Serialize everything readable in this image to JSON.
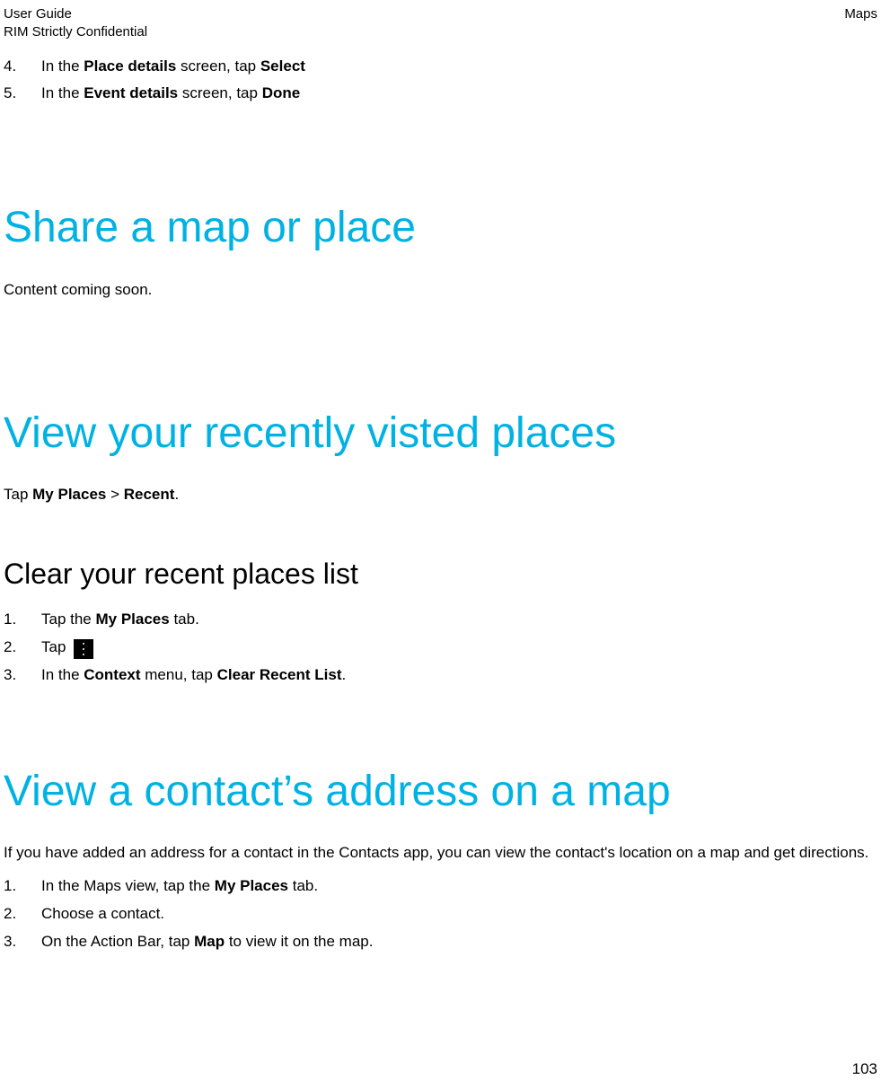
{
  "header": {
    "left_line1": "User Guide",
    "left_line2": "RIM Strictly Confidential",
    "right": "Maps"
  },
  "top_steps": [
    {
      "num": "4.",
      "pre": "In the ",
      "b1": "Place details",
      "mid": " screen, tap ",
      "b2": "Select",
      "post": ""
    },
    {
      "num": "5.",
      "pre": "In the ",
      "b1": "Event details",
      "mid": " screen, tap ",
      "b2": "Done",
      "post": ""
    }
  ],
  "section1": {
    "title": "Share a map or place",
    "body": "Content coming soon."
  },
  "section2": {
    "title": "View your recently visted places",
    "tap_line": {
      "pre": "Tap ",
      "b1": "My Places",
      "sep": " > ",
      "b2": "Recent",
      "post": "."
    },
    "sub_title": "Clear your recent places list",
    "steps": [
      {
        "num": "1.",
        "pre": "Tap the ",
        "b1": "My Places",
        "post": " tab."
      },
      {
        "num": "2.",
        "pre": "Tap ",
        "icon": true
      },
      {
        "num": "3.",
        "pre": "In the ",
        "b1": "Context",
        "mid": " menu, tap ",
        "b2": "Clear Recent List",
        "post": "."
      }
    ]
  },
  "section3": {
    "title": "View a contact’s address on a map",
    "intro": "If you have added an address for a contact in the Contacts app, you can view the contact's location on a map and get directions.",
    "steps": [
      {
        "num": "1.",
        "pre": "In the Maps view, tap the ",
        "b1": "My Places",
        "post": " tab."
      },
      {
        "num": "2.",
        "pre": "Choose a contact."
      },
      {
        "num": "3.",
        "pre": "On the Action Bar, tap ",
        "b1": "Map",
        "post": " to view it on the map."
      }
    ]
  },
  "page_number": "103"
}
